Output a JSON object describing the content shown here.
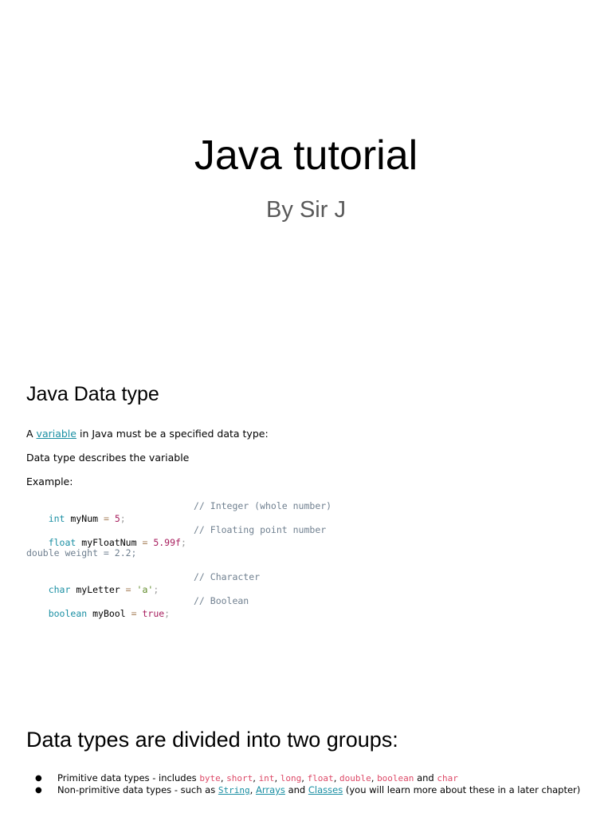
{
  "title": "Java tutorial",
  "subtitle": "By Sir J",
  "section1": {
    "heading": "Java Data type",
    "line1_prefix": "A",
    "line1_link": "variable",
    "line1_suffix": "in Java must be a specified data type:",
    "line2": "Data type describes the variable",
    "line3": "Example:",
    "code": [
      {
        "type": "int",
        "name": "myNum",
        "eq": "=",
        "value": "5",
        "end": ";",
        "comment": "// Integer (whole number)"
      },
      {
        "type": "float",
        "name": "myFloatNum",
        "eq": "=",
        "value": "5.99f",
        "end": ";",
        "comment": "// Floating point number"
      },
      {
        "plain": "double weight = 2.2;"
      },
      {
        "type": "char",
        "name": "myLetter",
        "eq": "=",
        "value": "'a'",
        "end": ";",
        "comment": "// Character"
      },
      {
        "type": "boolean",
        "name": "myBool",
        "eq": "=",
        "value": "true",
        "end": ";",
        "comment": "// Boolean"
      }
    ]
  },
  "section2": {
    "heading": "Data types are divided into two groups:",
    "bullet_glyph": "●",
    "bullet1": {
      "prefix": "Primitive data types - includes",
      "types": [
        "byte",
        "short",
        "int",
        "long",
        "float",
        "double",
        "boolean"
      ],
      "and": "and",
      "last": "char",
      "sep": ","
    },
    "bullet2": {
      "prefix": "Non-primitive data types - such as",
      "link1": "String",
      "sep": ",",
      "link2": "Arrays",
      "and": "and",
      "link3": "Classes",
      "suffix": "(you will learn more about these in a later chapter)"
    }
  },
  "colors": {
    "link": "#1a8fa3",
    "keyword": "#1a8fa3",
    "number": "#a71d5d",
    "string": "#608b2a",
    "comment": "#708090",
    "inline_code": "#dd4a68",
    "subtitle": "#595959"
  }
}
